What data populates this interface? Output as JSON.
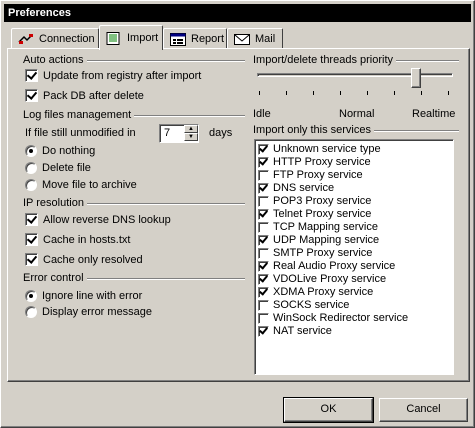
{
  "window": {
    "title": "Preferences"
  },
  "tabs": [
    {
      "label": "Connection",
      "icon": "connection-icon"
    },
    {
      "label": "Import",
      "icon": "import-icon",
      "active": true
    },
    {
      "label": "Report",
      "icon": "report-icon"
    },
    {
      "label": "Mail",
      "icon": "mail-icon"
    }
  ],
  "auto_actions": {
    "title": "Auto actions",
    "update_registry": {
      "label": "Update from registry after import",
      "checked": true
    },
    "pack_db": {
      "label": "Pack DB after delete",
      "checked": true
    }
  },
  "log_files": {
    "title": "Log files management",
    "unmodified_label": "If file still unmodified in",
    "days_value": "7",
    "days_label": "days",
    "options": [
      {
        "label": "Do nothing",
        "checked": true
      },
      {
        "label": "Delete file",
        "checked": false
      },
      {
        "label": "Move file to archive",
        "checked": false
      }
    ]
  },
  "ip_resolution": {
    "title": "IP resolution",
    "options": [
      {
        "label": "Allow reverse DNS lookup",
        "checked": true
      },
      {
        "label": "Cache in hosts.txt",
        "checked": true
      },
      {
        "label": "Cache only resolved",
        "checked": true
      }
    ]
  },
  "error_control": {
    "title": "Error control",
    "options": [
      {
        "label": "Ignore line with error",
        "checked": true
      },
      {
        "label": "Display error message",
        "checked": false
      }
    ]
  },
  "threads": {
    "title": "Import/delete threads priority",
    "idle": "Idle",
    "normal": "Normal",
    "realtime": "Realtime",
    "position": 0.83
  },
  "services": {
    "title": "Import only this services",
    "items": [
      {
        "label": "Unknown service type",
        "checked": true
      },
      {
        "label": "HTTP Proxy service",
        "checked": true
      },
      {
        "label": "FTP Proxy service",
        "checked": false
      },
      {
        "label": "DNS service",
        "checked": true
      },
      {
        "label": "POP3 Proxy service",
        "checked": false
      },
      {
        "label": "Telnet Proxy service",
        "checked": true
      },
      {
        "label": "TCP Mapping service",
        "checked": false
      },
      {
        "label": "UDP Mapping service",
        "checked": true
      },
      {
        "label": "SMTP Proxy service",
        "checked": false
      },
      {
        "label": "Real Audio Proxy service",
        "checked": true
      },
      {
        "label": "VDOLive Proxy service",
        "checked": true
      },
      {
        "label": "XDMA Proxy service",
        "checked": true
      },
      {
        "label": "SOCKS service",
        "checked": false
      },
      {
        "label": "WinSock Redirector service",
        "checked": false
      },
      {
        "label": "NAT service",
        "checked": true
      }
    ]
  },
  "buttons": {
    "ok": "OK",
    "cancel": "Cancel"
  }
}
